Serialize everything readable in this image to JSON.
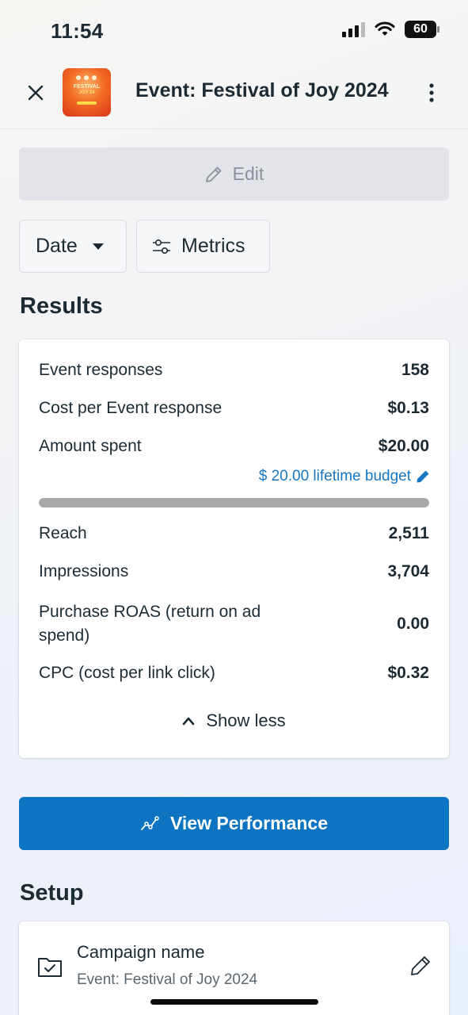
{
  "status_bar": {
    "time": "11:54",
    "battery": "60",
    "icons": [
      "signal-icon",
      "wifi-icon",
      "battery-icon"
    ]
  },
  "header": {
    "title": "Event: Festival of Joy 2024",
    "thumbnail_text_1": "FESTIVAL",
    "thumbnail_text_2": "JOY 24"
  },
  "actions": {
    "edit_label": "Edit",
    "date_label": "Date",
    "metrics_label": "Metrics"
  },
  "results": {
    "title": "Results",
    "rows": [
      {
        "label": "Event responses",
        "value": "158"
      },
      {
        "label": "Cost per Event response",
        "value": "$0.13"
      },
      {
        "label": "Amount spent",
        "value": "$20.00"
      }
    ],
    "budget_link": "$ 20.00 lifetime budget",
    "budget_progress": 1.0,
    "rows2": [
      {
        "label": "Reach",
        "value": "2,511"
      },
      {
        "label": "Impressions",
        "value": "3,704"
      },
      {
        "label": "Purchase ROAS (return on ad spend)",
        "value": "0.00"
      },
      {
        "label": "CPC (cost per link click)",
        "value": "$0.32"
      }
    ],
    "show_less": "Show less"
  },
  "view_performance": "View Performance",
  "setup": {
    "title": "Setup",
    "campaign_label": "Campaign name",
    "campaign_value": "Event: Festival of Joy 2024"
  },
  "colors": {
    "primary": "#0c74c0",
    "link": "#1877c2",
    "text": "#1c2b33",
    "progress_fill": "#a8a8a8"
  }
}
